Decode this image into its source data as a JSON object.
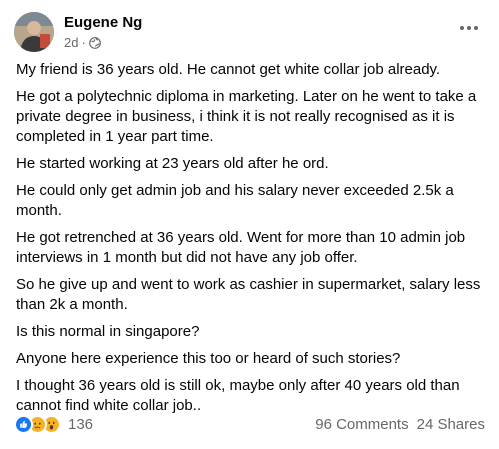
{
  "post": {
    "author": "Eugene Ng",
    "time": "2d",
    "separator": "·",
    "paragraphs": [
      "My friend is 36 years old. He cannot get white collar job already.",
      "He got a polytechnic diploma in marketing. Later on he went to take a private degree in business, i think it is not really recognised as it is completed in 1 year part time.",
      "He started working at 23 years old after he ord.",
      "He could only get admin job and his salary never exceeded 2.5k a month.",
      "He got retrenched at 36 years old. Went for more than 10 admin job interviews in 1 month but did not have any job offer.",
      "So he give up and went to work as cashier in supermarket, salary less than 2k a month.",
      "Is this normal in singapore?",
      "Anyone here experience this too or heard of such stories?",
      "I thought 36 years old is still ok, maybe only after 40 years old than cannot find white collar job.."
    ]
  },
  "footer": {
    "reaction_count": "136",
    "comments": "96 Comments",
    "shares": "24 Shares",
    "reaction_icons": [
      "like-icon",
      "sad-icon",
      "wow-icon"
    ]
  },
  "colors": {
    "like": "#1877f2",
    "emoji": "#f7b125",
    "secondary_text": "#65676b"
  }
}
